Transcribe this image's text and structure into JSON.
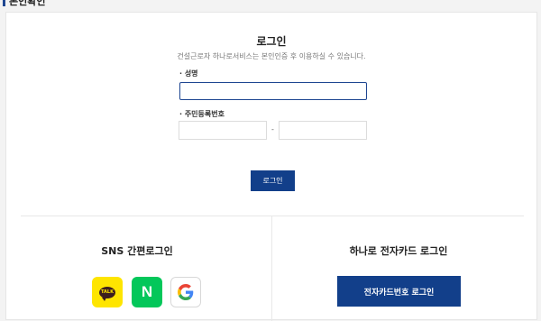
{
  "section": {
    "title": "본인확인"
  },
  "login": {
    "title": "로그인",
    "description": "건설근로자 하나로서비스는 본인인증 후 이용하실 수 있습니다.",
    "name_label": "· 성명",
    "name_value": "",
    "rrn_label": "· 주민등록번호",
    "rrn_first_value": "",
    "rrn_separator": "-",
    "rrn_second_value": "",
    "button_label": "로그인"
  },
  "sns": {
    "title": "SNS 간편로그인",
    "providers": [
      {
        "name": "kakao",
        "icon": "kakao-talk-icon",
        "icon_text": "TALK",
        "color": "#FEE500"
      },
      {
        "name": "naver",
        "icon": "naver-icon",
        "icon_text": "N",
        "color": "#03C75A"
      },
      {
        "name": "google",
        "icon": "google-icon",
        "color": "#FFFFFF"
      }
    ]
  },
  "card_login": {
    "title": "하나로 전자카드 로그인",
    "button_label": "전자카드번호 로그인"
  },
  "colors": {
    "accent": "#123F8A",
    "focus_border": "#1E4691"
  }
}
